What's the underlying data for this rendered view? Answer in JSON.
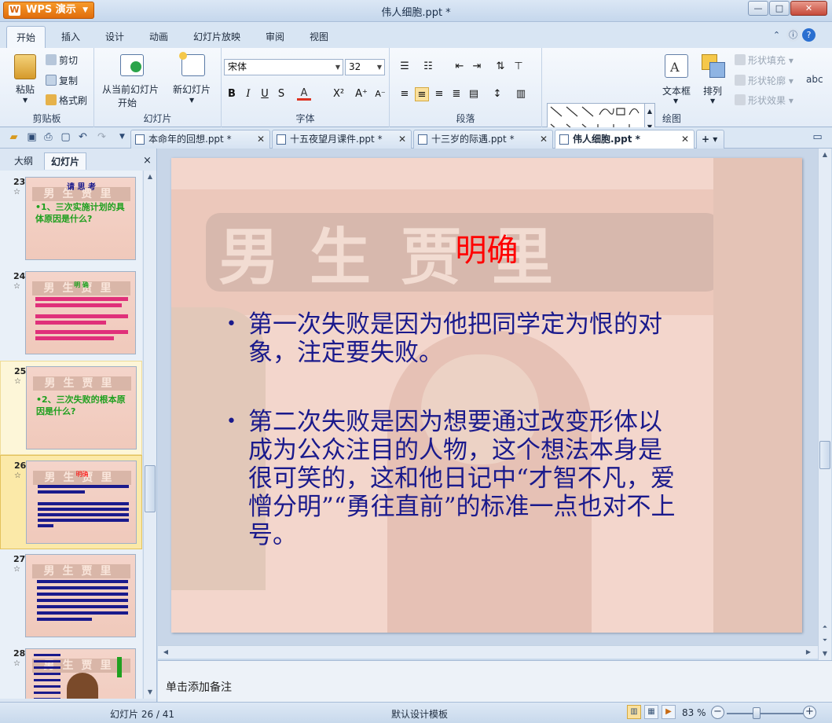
{
  "app": {
    "name": "WPS 演示",
    "window_title": "伟人细胞.ppt *"
  },
  "window_controls": {
    "minimize": "—",
    "restore": "□",
    "close": "✕"
  },
  "ribbon_tabs": [
    "开始",
    "插入",
    "设计",
    "动画",
    "幻灯片放映",
    "审阅",
    "视图"
  ],
  "ribbon_right_icons": [
    "up-arrow-icon",
    "help-icon",
    "question-icon"
  ],
  "ribbon": {
    "clipboard": {
      "paste": "粘贴",
      "cut": "剪切",
      "copy": "复制",
      "format_painter": "格式刷",
      "group": "剪贴板"
    },
    "slides": {
      "from_current": "从当前幻灯片",
      "from_current_line2": "开始",
      "new_slide": "新幻灯片",
      "group": "幻灯片"
    },
    "font": {
      "name": "宋体",
      "size": "32",
      "bold": "B",
      "italic": "I",
      "underline": "U",
      "shadow": "S",
      "color": "A",
      "superscript": "X²",
      "grow": "A⁺",
      "shrink": "A⁻",
      "group": "字体"
    },
    "paragraph": {
      "group": "段落"
    },
    "drawing": {
      "textbox": "文本框",
      "arrange": "排列",
      "shape_fill": "形状填充",
      "shape_outline": "形状轮廓",
      "shape_effect": "形状效果",
      "group": "绘图"
    }
  },
  "doc_tabs": [
    {
      "label": "本命年的回想.ppt *",
      "active": false
    },
    {
      "label": "十五夜望月课件.ppt *",
      "active": false
    },
    {
      "label": "十三岁的际遇.ppt *",
      "active": false
    },
    {
      "label": "伟人细胞.ppt *",
      "active": true
    }
  ],
  "left_panel": {
    "tabs": [
      "大纲",
      "幻灯片"
    ],
    "active_tab": "幻灯片",
    "close": "×",
    "thumbnails": [
      {
        "num": "23",
        "lines": [
          "请 思 考",
          "•1、三次实施计划的具体原因是什么?"
        ],
        "selected": false
      },
      {
        "num": "24",
        "lines": [
          "明 确"
        ],
        "selected": false
      },
      {
        "num": "25",
        "lines": [
          "•2、三次失败的根本原因是什么?"
        ],
        "selected": false
      },
      {
        "num": "26",
        "lines": [
          "明确"
        ],
        "selected": true
      },
      {
        "num": "27",
        "lines": [],
        "selected": false
      },
      {
        "num": "28",
        "lines": [],
        "selected": false
      }
    ]
  },
  "slide": {
    "title": "明确",
    "bullets": [
      "第一次失败是因为他把同学定为恨的对象，注定要失败。",
      "第二次失败是因为想要通过改变形体以成为公众注目的人物，这个想法本身是很可笑的，这和他日记中“才智不凡，爱憎分明”“勇往直前”的标准一点也对不上号。"
    ],
    "bg_text": "男生贾里",
    "bullet_lines": [
      [
        "第一次失败是因为他把同学定为恨的对",
        "象，注定要失败。"
      ],
      [
        "第二次失败是因为想要通过改变形体以",
        "成为公众注目的人物，这个想法本身是",
        "很可笑的，这和他日记中“才智不凡，爱",
        "憎分明”“勇往直前”的标准一点也对不上",
        "号。"
      ]
    ]
  },
  "notes_placeholder": "单击添加备注",
  "status": {
    "slide_pos": "幻灯片 26 / 41",
    "template": "默认设计模板",
    "zoom": "83 %"
  },
  "colors": {
    "accent_orange": "#e06d0c",
    "slide_title": "#ff0000",
    "slide_text": "#1a1a8c",
    "selection": "#fbe9a8"
  }
}
